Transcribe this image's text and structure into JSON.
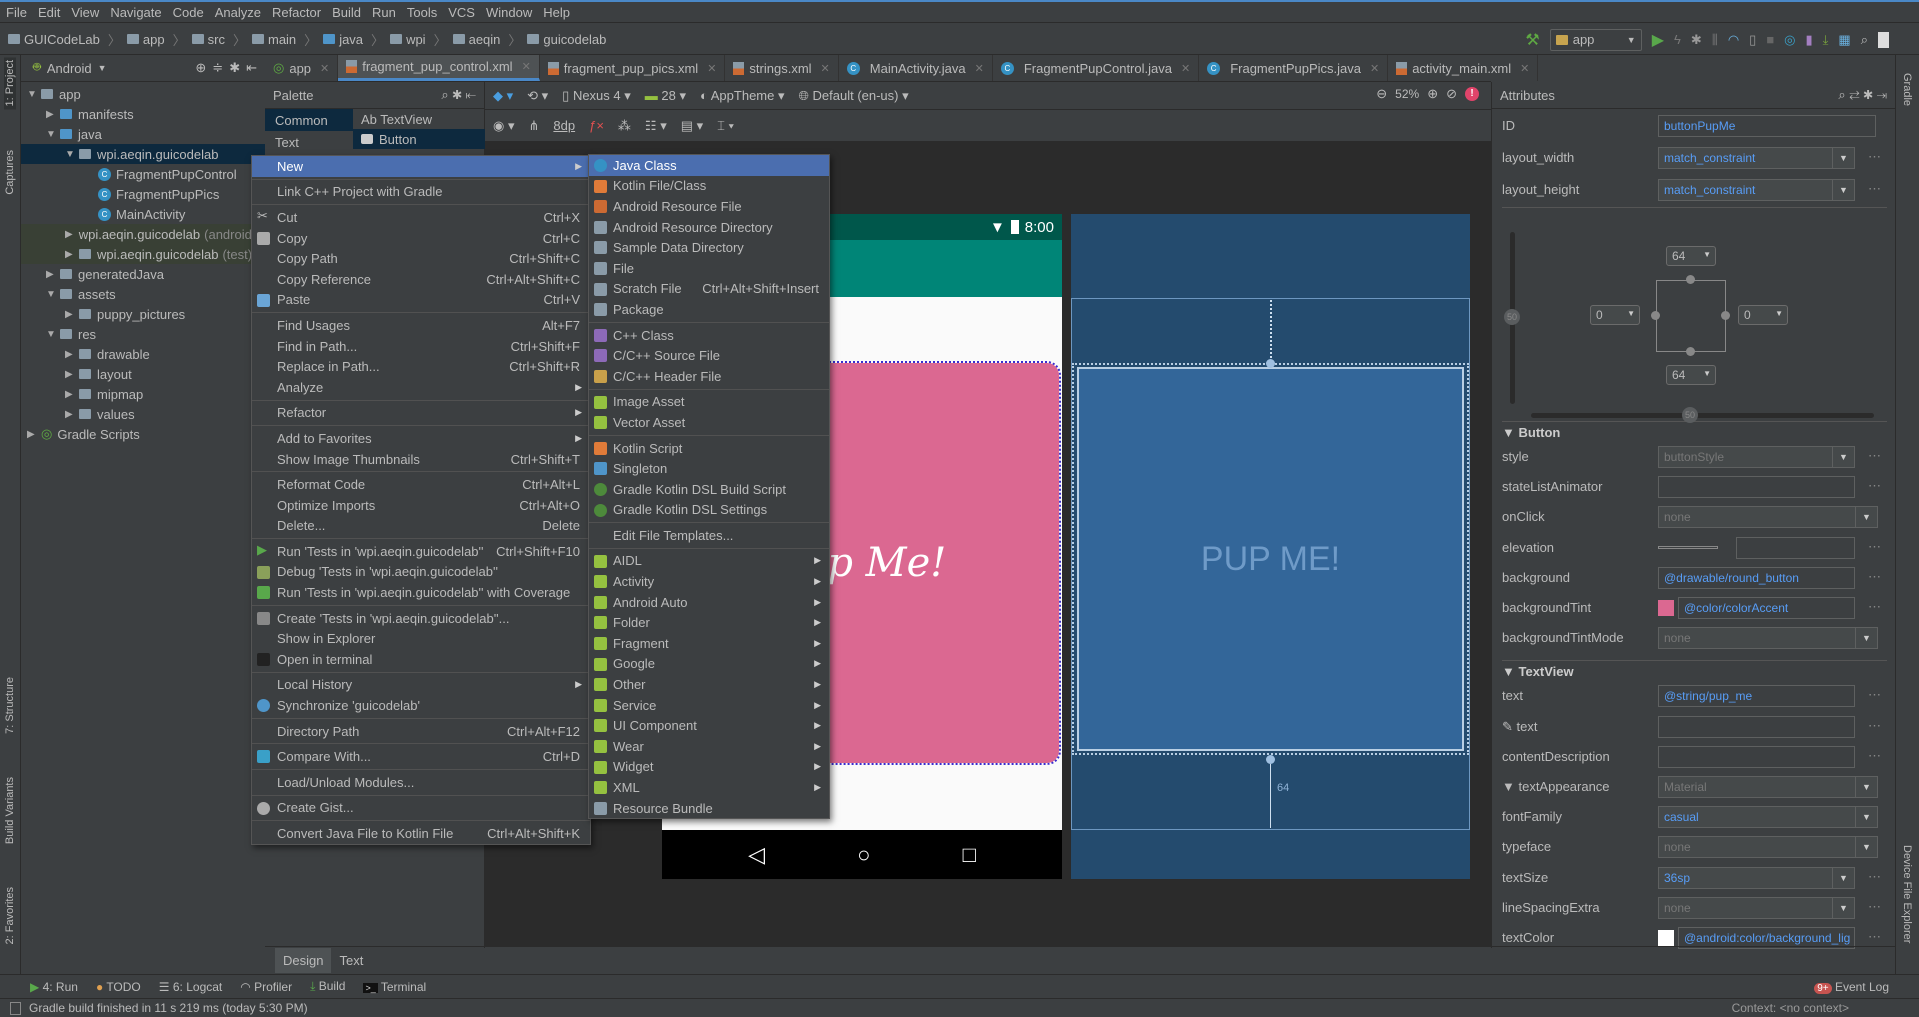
{
  "menubar": [
    "File",
    "Edit",
    "View",
    "Navigate",
    "Code",
    "Analyze",
    "Refactor",
    "Build",
    "Run",
    "Tools",
    "VCS",
    "Window",
    "Help"
  ],
  "breadcrumb": [
    "GUICodeLab",
    "app",
    "src",
    "main",
    "java",
    "wpi",
    "aeqin",
    "guicodelab"
  ],
  "run_config": "app",
  "left_stripe": {
    "project": "1: Project",
    "captures": "Captures",
    "structure": "7: Structure",
    "build_variants": "Build Variants",
    "favorites": "2: Favorites"
  },
  "right_stripe": {
    "gradle": "Gradle",
    "device_file_explorer": "Device File Explorer"
  },
  "project_panel": {
    "view_mode": "Android",
    "tree": [
      {
        "label": "app",
        "depth": 0,
        "arrow": "down",
        "icon": "module"
      },
      {
        "label": "manifests",
        "depth": 1,
        "arrow": "right",
        "icon": "folder-blue"
      },
      {
        "label": "java",
        "depth": 1,
        "arrow": "down",
        "icon": "folder-blue"
      },
      {
        "label": "wpi.aeqin.guicodelab",
        "depth": 2,
        "arrow": "down",
        "icon": "package",
        "state": "selected"
      },
      {
        "label": "FragmentPupControl",
        "depth": 3,
        "arrow": "",
        "icon": "class"
      },
      {
        "label": "FragmentPupPics",
        "depth": 3,
        "arrow": "",
        "icon": "class"
      },
      {
        "label": "MainActivity",
        "depth": 3,
        "arrow": "",
        "icon": "class"
      },
      {
        "label": "wpi.aeqin.guicodelab",
        "suffix": "(androidTest)",
        "depth": 2,
        "arrow": "right",
        "icon": "package",
        "state": "green"
      },
      {
        "label": "wpi.aeqin.guicodelab",
        "suffix": "(test)",
        "depth": 2,
        "arrow": "right",
        "icon": "package",
        "state": "green"
      },
      {
        "label": "generatedJava",
        "depth": 1,
        "arrow": "right",
        "icon": "folder-gen"
      },
      {
        "label": "assets",
        "depth": 1,
        "arrow": "down",
        "icon": "folder-res"
      },
      {
        "label": "puppy_pictures",
        "depth": 2,
        "arrow": "right",
        "icon": "package"
      },
      {
        "label": "res",
        "depth": 1,
        "arrow": "down",
        "icon": "folder-res"
      },
      {
        "label": "drawable",
        "depth": 2,
        "arrow": "right",
        "icon": "package"
      },
      {
        "label": "layout",
        "depth": 2,
        "arrow": "right",
        "icon": "package"
      },
      {
        "label": "mipmap",
        "depth": 2,
        "arrow": "right",
        "icon": "package"
      },
      {
        "label": "values",
        "depth": 2,
        "arrow": "right",
        "icon": "package"
      },
      {
        "label": "Gradle Scripts",
        "depth": 0,
        "arrow": "right",
        "icon": "gradle"
      }
    ]
  },
  "tabs": [
    {
      "label": "app",
      "icon": "gradle",
      "active": false
    },
    {
      "label": "fragment_pup_control.xml",
      "icon": "xml",
      "active": true
    },
    {
      "label": "fragment_pup_pics.xml",
      "icon": "xml",
      "active": false
    },
    {
      "label": "strings.xml",
      "icon": "xml",
      "active": false
    },
    {
      "label": "MainActivity.java",
      "icon": "class",
      "active": false
    },
    {
      "label": "FragmentPupControl.java",
      "icon": "class",
      "active": false
    },
    {
      "label": "FragmentPupPics.java",
      "icon": "class",
      "active": false
    },
    {
      "label": "activity_main.xml",
      "icon": "xml",
      "active": false
    }
  ],
  "palette": {
    "title": "Palette",
    "categories": [
      "Common",
      "Text"
    ],
    "items": [
      "Ab TextView",
      "Button"
    ]
  },
  "design_toolbar": {
    "device": "Nexus 4",
    "api": "28",
    "theme": "AppTheme",
    "locale": "Default (en-us)",
    "zoom": "52%",
    "margin": "8dp"
  },
  "phone": {
    "time": "8:00",
    "button_text": "Pup Me!",
    "colors": {
      "status": "#00574b",
      "toolbar": "#008577",
      "button": "#db6891"
    }
  },
  "blueprint": {
    "button_text": "PUP ME!",
    "bottom_margin": "64"
  },
  "context_menu": [
    {
      "label": "New",
      "submenu": true,
      "active": true
    },
    {
      "sep": true
    },
    {
      "label": "Link C++ Project with Gradle"
    },
    {
      "sep": true
    },
    {
      "label": "Cut",
      "shortcut": "Ctrl+X",
      "icon": "scissors"
    },
    {
      "label": "Copy",
      "shortcut": "Ctrl+C",
      "icon": "copy"
    },
    {
      "label": "Copy Path",
      "shortcut": "Ctrl+Shift+C"
    },
    {
      "label": "Copy Reference",
      "shortcut": "Ctrl+Alt+Shift+C"
    },
    {
      "label": "Paste",
      "shortcut": "Ctrl+V",
      "icon": "paste"
    },
    {
      "sep": true
    },
    {
      "label": "Find Usages",
      "shortcut": "Alt+F7"
    },
    {
      "label": "Find in Path...",
      "shortcut": "Ctrl+Shift+F"
    },
    {
      "label": "Replace in Path...",
      "shortcut": "Ctrl+Shift+R"
    },
    {
      "label": "Analyze",
      "submenu": true
    },
    {
      "sep": true
    },
    {
      "label": "Refactor",
      "submenu": true
    },
    {
      "sep": true
    },
    {
      "label": "Add to Favorites",
      "submenu": true
    },
    {
      "label": "Show Image Thumbnails",
      "shortcut": "Ctrl+Shift+T"
    },
    {
      "sep": true
    },
    {
      "label": "Reformat Code",
      "shortcut": "Ctrl+Alt+L"
    },
    {
      "label": "Optimize Imports",
      "shortcut": "Ctrl+Alt+O"
    },
    {
      "label": "Delete...",
      "shortcut": "Delete"
    },
    {
      "sep": true
    },
    {
      "label": "Run 'Tests in 'wpi.aeqin.guicodelab''",
      "shortcut": "Ctrl+Shift+F10",
      "icon": "run"
    },
    {
      "label": "Debug 'Tests in 'wpi.aeqin.guicodelab''",
      "icon": "debug"
    },
    {
      "label": "Run 'Tests in 'wpi.aeqin.guicodelab'' with Coverage",
      "icon": "coverage"
    },
    {
      "sep": true
    },
    {
      "label": "Create 'Tests in 'wpi.aeqin.guicodelab''...",
      "icon": "create-test"
    },
    {
      "label": "Show in Explorer"
    },
    {
      "label": "Open in terminal",
      "icon": "terminal"
    },
    {
      "sep": true
    },
    {
      "label": "Local History",
      "submenu": true
    },
    {
      "label": "Synchronize 'guicodelab'",
      "icon": "sync"
    },
    {
      "sep": true
    },
    {
      "label": "Directory Path",
      "shortcut": "Ctrl+Alt+F12"
    },
    {
      "sep": true
    },
    {
      "label": "Compare With...",
      "shortcut": "Ctrl+D",
      "icon": "compare"
    },
    {
      "sep": true
    },
    {
      "label": "Load/Unload Modules..."
    },
    {
      "sep": true
    },
    {
      "label": "Create Gist...",
      "icon": "github"
    },
    {
      "sep": true
    },
    {
      "label": "Convert Java File to Kotlin File",
      "shortcut": "Ctrl+Alt+Shift+K"
    }
  ],
  "new_submenu": [
    {
      "label": "Java Class",
      "icon": "class",
      "active": true
    },
    {
      "label": "Kotlin File/Class",
      "icon": "kotlin"
    },
    {
      "label": "Android Resource File",
      "icon": "xml"
    },
    {
      "label": "Android Resource Directory",
      "icon": "folder"
    },
    {
      "label": "Sample Data Directory",
      "icon": "folder"
    },
    {
      "label": "File",
      "icon": "file"
    },
    {
      "label": "Scratch File",
      "shortcut": "Ctrl+Alt+Shift+Insert",
      "icon": "scratch"
    },
    {
      "label": "Package",
      "icon": "package"
    },
    {
      "sep": true
    },
    {
      "label": "C++ Class",
      "icon": "cpp-class"
    },
    {
      "label": "C/C++ Source File",
      "icon": "cpp"
    },
    {
      "label": "C/C++ Header File",
      "icon": "header"
    },
    {
      "sep": true
    },
    {
      "label": "Image Asset",
      "icon": "android"
    },
    {
      "label": "Vector Asset",
      "icon": "android"
    },
    {
      "sep": true
    },
    {
      "label": "Kotlin Script",
      "icon": "kotlin"
    },
    {
      "label": "Singleton",
      "icon": "singleton"
    },
    {
      "label": "Gradle Kotlin DSL Build Script",
      "icon": "gradle-g"
    },
    {
      "label": "Gradle Kotlin DSL Settings",
      "icon": "gradle-g"
    },
    {
      "sep": true
    },
    {
      "label": "Edit File Templates..."
    },
    {
      "sep": true
    },
    {
      "label": "AIDL",
      "icon": "android",
      "submenu": true
    },
    {
      "label": "Activity",
      "icon": "android",
      "submenu": true
    },
    {
      "label": "Android Auto",
      "icon": "android",
      "submenu": true
    },
    {
      "label": "Folder",
      "icon": "android",
      "submenu": true
    },
    {
      "label": "Fragment",
      "icon": "android",
      "submenu": true
    },
    {
      "label": "Google",
      "icon": "android",
      "submenu": true
    },
    {
      "label": "Other",
      "icon": "android",
      "submenu": true
    },
    {
      "label": "Service",
      "icon": "android",
      "submenu": true
    },
    {
      "label": "UI Component",
      "icon": "android",
      "submenu": true
    },
    {
      "label": "Wear",
      "icon": "android",
      "submenu": true
    },
    {
      "label": "Widget",
      "icon": "android",
      "submenu": true
    },
    {
      "label": "XML",
      "icon": "android",
      "submenu": true
    },
    {
      "label": "Resource Bundle",
      "icon": "bundle"
    }
  ],
  "attributes": {
    "title": "Attributes",
    "top": [
      {
        "label": "ID",
        "value": "buttonPupMe",
        "kind": "text"
      },
      {
        "label": "layout_width",
        "value": "match_constraint",
        "kind": "select",
        "dots": true
      },
      {
        "label": "layout_height",
        "value": "match_constraint",
        "kind": "select",
        "dots": true
      }
    ],
    "constraints": {
      "top": "64",
      "bottom": "64",
      "left": "0",
      "right": "0",
      "vertical_bias": "50",
      "horizontal_bias": "50"
    },
    "sections": [
      {
        "title": "Button",
        "rows": [
          {
            "label": "style",
            "value": "buttonStyle",
            "kind": "select",
            "muted": true,
            "dots": true
          },
          {
            "label": "stateListAnimator",
            "value": "",
            "kind": "text",
            "dots": true
          },
          {
            "label": "onClick",
            "value": "none",
            "kind": "select",
            "muted": true,
            "wide": true
          },
          {
            "label": "elevation",
            "value": "",
            "kind": "slider",
            "dots": true
          },
          {
            "label": "background",
            "value": "@drawable/round_button",
            "kind": "text",
            "dots": true
          },
          {
            "label": "backgroundTint",
            "value": "@color/colorAccent",
            "kind": "swatch",
            "color": "#db6891",
            "dots": true
          },
          {
            "label": "backgroundTintMode",
            "value": "none",
            "kind": "select",
            "muted": true,
            "wide": true
          }
        ]
      },
      {
        "title": "TextView",
        "rows": [
          {
            "label": "text",
            "value": "@string/pup_me",
            "kind": "text",
            "dots": true
          },
          {
            "label": "✎ text",
            "value": "",
            "kind": "text",
            "dots": true
          },
          {
            "label": "contentDescription",
            "value": "",
            "kind": "text",
            "dots": true
          },
          {
            "label": "▼ textAppearance",
            "value": "Material",
            "kind": "select",
            "muted": true,
            "wide": true
          },
          {
            "label": "fontFamily",
            "value": "casual",
            "kind": "select",
            "wide": true
          },
          {
            "label": "typeface",
            "value": "none",
            "kind": "select",
            "muted": true,
            "wide": true
          },
          {
            "label": "textSize",
            "value": "36sp",
            "kind": "select",
            "dots": true
          },
          {
            "label": "lineSpacingExtra",
            "value": "none",
            "kind": "select",
            "muted": true,
            "dots": true
          },
          {
            "label": "textColor",
            "value": "@android:color/background_lig",
            "kind": "swatch",
            "color": "#ffffff",
            "dots": true
          }
        ]
      }
    ]
  },
  "design_tabs": [
    "Design",
    "Text"
  ],
  "bottom_tools": [
    "4: Run",
    "TODO",
    "6: Logcat",
    "Profiler",
    "Build",
    "Terminal"
  ],
  "event_log": {
    "label": "Event Log",
    "badge": "9+"
  },
  "status": {
    "message": "Gradle build finished in 11 s 219 ms (today 5:30 PM)",
    "context": "Context: <no context>"
  }
}
